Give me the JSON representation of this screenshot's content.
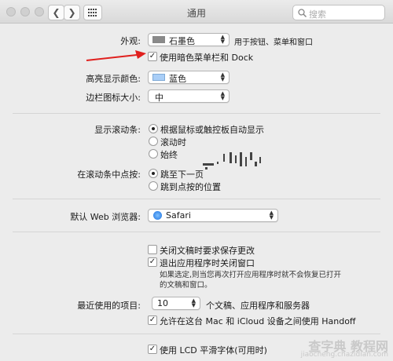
{
  "window": {
    "title": "通用",
    "search_placeholder": "搜索"
  },
  "appearance": {
    "label": "外观:",
    "value": "石墨色",
    "hint": "用于按钮、菜单和窗口",
    "dark_menu_checkbox": {
      "label": "使用暗色菜单栏和 Dock",
      "checked": true
    }
  },
  "highlight": {
    "label": "高亮显示颜色:",
    "value": "蓝色",
    "swatch_color": "#a9cef7"
  },
  "sidebar_icon": {
    "label": "边栏图标大小:",
    "value": "中"
  },
  "scrollbars": {
    "label": "显示滚动条:",
    "options": [
      "根据鼠标或触控板自动显示",
      "滚动时",
      "始终"
    ],
    "selected": 0
  },
  "click_scrollbar": {
    "label": "在滚动条中点按:",
    "options": [
      "跳至下一页",
      "跳到点按的位置"
    ],
    "selected": 0
  },
  "browser": {
    "label": "默认 Web 浏览器:",
    "value": "Safari"
  },
  "docs": {
    "ask_save": {
      "label": "关闭文稿时要求保存更改",
      "checked": false
    },
    "close_windows": {
      "label": "退出应用程序时关闭窗口",
      "checked": true
    },
    "note": "如果选定,则当您再次打开应用程序时就不会恢复已打开的文稿和窗口。"
  },
  "recent": {
    "label": "最近使用的项目:",
    "value": "10",
    "suffix": "个文稿、应用程序和服务器"
  },
  "handoff": {
    "label": "允许在这台 Mac 和 iCloud 设备之间使用 Handoff",
    "checked": true
  },
  "lcd": {
    "label": "使用 LCD 平滑字体(可用时)",
    "checked": true
  },
  "watermark": {
    "line1": "查字典 教程网",
    "line2": "jiaocheng.chazidian.com"
  },
  "colors": {
    "arrow": "#e0201e",
    "separator": "#d5d5d5"
  }
}
